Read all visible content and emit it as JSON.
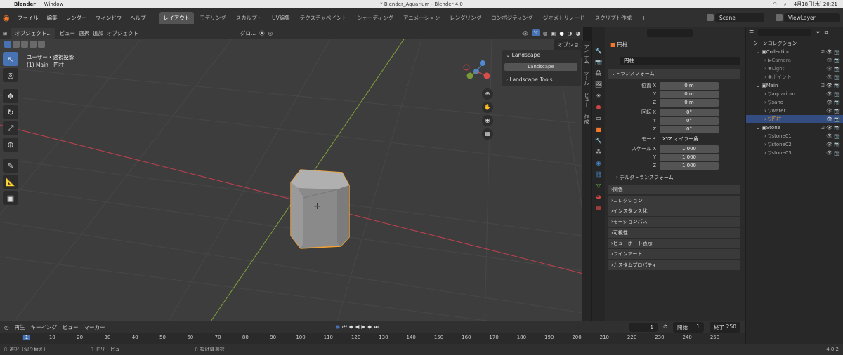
{
  "mac": {
    "apple": "",
    "app": "Blender",
    "menu": "Window",
    "title": "* Blender_Aquarium - Blender 4.0",
    "date": "4月18日(木)  20:21"
  },
  "topbar": {
    "menus": [
      "ファイル",
      "編集",
      "レンダー",
      "ウィンドウ",
      "ヘルプ"
    ],
    "workspaces": [
      "レイアウト",
      "モデリング",
      "スカルプト",
      "UV編集",
      "テクスチャペイント",
      "シェーディング",
      "アニメーション",
      "レンダリング",
      "コンポジティング",
      "ジオメトリノード",
      "スクリプト作成"
    ],
    "add": "+",
    "scene": "Scene",
    "viewlayer": "ViewLayer"
  },
  "vp_header": {
    "mode": "オブジェクト...",
    "menus": [
      "ビュー",
      "選択",
      "追加",
      "オブジェクト"
    ],
    "transform": "グロ...",
    "options": "オプション"
  },
  "viewport": {
    "persp": "ユーザー・透視投影",
    "collection": "(1) Main | 円柱"
  },
  "npanel": {
    "section": "Landscape",
    "button": "Landscape",
    "tools": "Landscape Tools",
    "tabs": [
      "アイテム",
      "ツール",
      "ビュー",
      "作成"
    ]
  },
  "props": {
    "object_name": "円柱",
    "object_field": "円柱",
    "section": "トランスフォーム",
    "rows": [
      {
        "label": "位置 X",
        "value": "0 m"
      },
      {
        "label": "Y",
        "value": "0 m"
      },
      {
        "label": "Z",
        "value": "0 m"
      },
      {
        "label": "回転 X",
        "value": "0°"
      },
      {
        "label": "Y",
        "value": "0°"
      },
      {
        "label": "Z",
        "value": "0°"
      },
      {
        "label": "モード",
        "value": "XYZ オイラー角"
      },
      {
        "label": "スケール X",
        "value": "1.000"
      },
      {
        "label": "Y",
        "value": "1.000"
      },
      {
        "label": "Z",
        "value": "1.000"
      }
    ],
    "delta": "デルタトランスフォーム",
    "sections": [
      "関係",
      "コレクション",
      "インスタンス化",
      "モーションパス",
      "可視性",
      "ビューポート表示",
      "ラインアート",
      "カスタムプロパティ"
    ]
  },
  "outliner": {
    "title": "シーンコレクション",
    "rows": [
      {
        "name": "Collection",
        "depth": 1
      },
      {
        "name": "Camera",
        "depth": 2
      },
      {
        "name": "Light",
        "depth": 2
      },
      {
        "name": "ポイント",
        "depth": 2
      },
      {
        "name": "Main",
        "depth": 1
      },
      {
        "name": "aquarium",
        "depth": 2
      },
      {
        "name": "sand",
        "depth": 2
      },
      {
        "name": "water",
        "depth": 2
      },
      {
        "name": "円柱",
        "depth": 2,
        "selected": true
      },
      {
        "name": "Stone",
        "depth": 1
      },
      {
        "name": "stone01",
        "depth": 2
      },
      {
        "name": "stone02",
        "depth": 2
      },
      {
        "name": "stone03",
        "depth": 2
      }
    ]
  },
  "timeline": {
    "menus": [
      "再生",
      "キーイング",
      "ビュー",
      "マーカー"
    ],
    "current": "1",
    "start_label": "開始",
    "start": "1",
    "end_label": "終了",
    "end": "250",
    "ticks": [
      "1",
      "10",
      "20",
      "30",
      "40",
      "50",
      "60",
      "70",
      "80",
      "90",
      "100",
      "110",
      "120",
      "130",
      "140",
      "150",
      "160",
      "170",
      "180",
      "190",
      "200",
      "210",
      "220",
      "230",
      "240",
      "250"
    ]
  },
  "status": {
    "select": "選択（切り替え）",
    "pan": "ドリービュー",
    "lasso": "投げ縄選択",
    "version": "4.0.2"
  },
  "colors": {
    "accent": "#4772b3",
    "selection": "#f2a132",
    "grid": "#4a4a4a",
    "x_axis": "#c1404f",
    "y_axis": "#7fa33a"
  }
}
